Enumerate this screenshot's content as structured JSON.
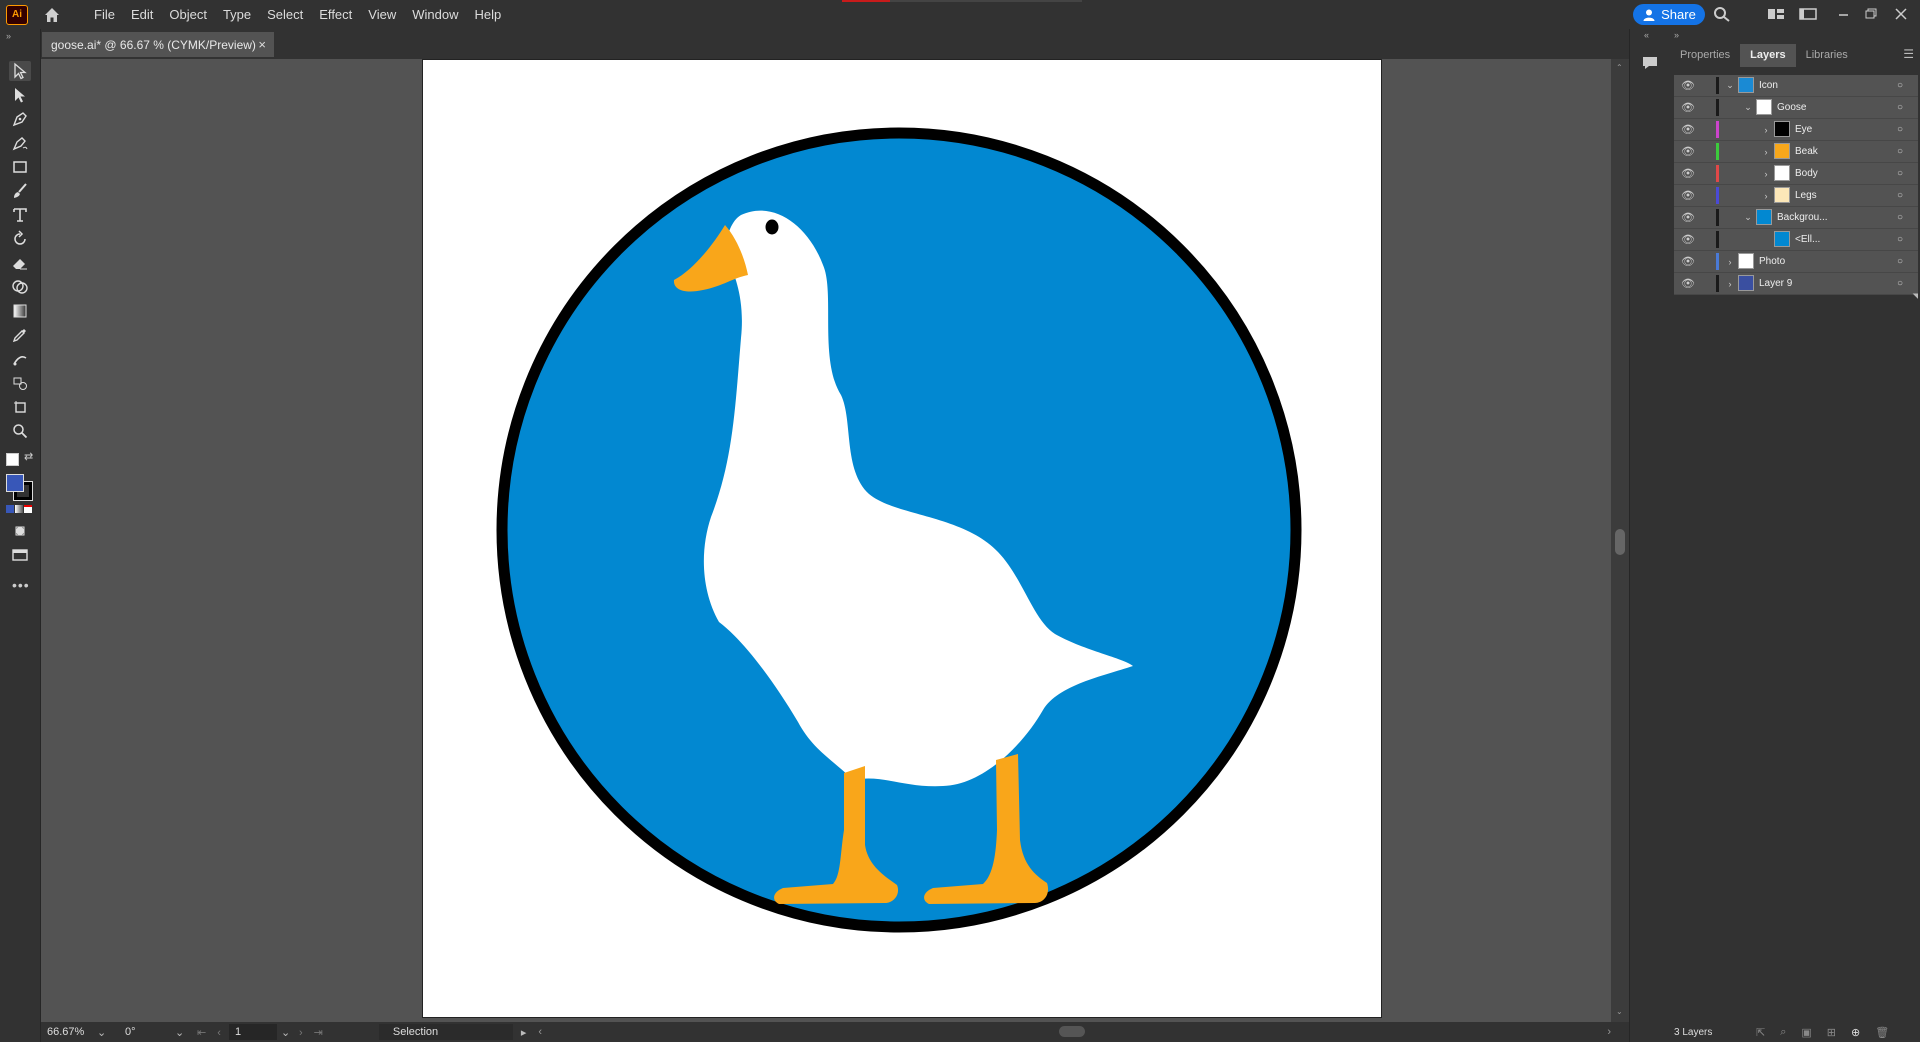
{
  "app": {
    "logo_text": "Ai"
  },
  "menu": {
    "items": [
      "File",
      "Edit",
      "Object",
      "Type",
      "Select",
      "Effect",
      "View",
      "Window",
      "Help"
    ]
  },
  "share": {
    "label": "Share"
  },
  "document": {
    "tab_title": "goose.ai* @ 66.67 % (CYMK/Preview)",
    "close_glyph": "×"
  },
  "status": {
    "zoom": "66.67%",
    "rotation": "0°",
    "artboard": "1",
    "tool": "Selection"
  },
  "panels": {
    "tabs": [
      "Properties",
      "Layers",
      "Libraries"
    ],
    "active_tab": "Layers",
    "layer_count": "3 Layers"
  },
  "layers": [
    {
      "name": "Icon",
      "indent": 0,
      "chevron": "⌄",
      "bar": "#1a1a1a",
      "thumb": "#1a8ad4"
    },
    {
      "name": "Goose",
      "indent": 1,
      "chevron": "⌄",
      "bar": "#1a1a1a",
      "thumb": "#ffffff"
    },
    {
      "name": "Eye",
      "indent": 2,
      "chevron": "›",
      "bar": "#cc44cc",
      "thumb": "#000000"
    },
    {
      "name": "Beak",
      "indent": 2,
      "chevron": "›",
      "bar": "#3ccb3c",
      "thumb": "#f7a71b"
    },
    {
      "name": "Body",
      "indent": 2,
      "chevron": "›",
      "bar": "#e04848",
      "thumb": "#ffffff"
    },
    {
      "name": "Legs",
      "indent": 2,
      "chevron": "›",
      "bar": "#4a4ad6",
      "thumb": "#fce7b8"
    },
    {
      "name": "Backgrou...",
      "indent": 1,
      "chevron": "⌄",
      "bar": "#1a1a1a",
      "thumb": "#0288d1"
    },
    {
      "name": "<Ell...",
      "indent": 2,
      "chevron": "",
      "bar": "#1a1a1a",
      "thumb": "#0288d1"
    },
    {
      "name": "Photo",
      "indent": 0,
      "chevron": "›",
      "bar": "#4a7ad6",
      "thumb": "#ffffff"
    },
    {
      "name": "Layer 9",
      "indent": 0,
      "chevron": "›",
      "bar": "#1a1a1a",
      "thumb": "#3a4fa0"
    }
  ],
  "artwork": {
    "circle_fill": "#0288d1",
    "circle_stroke": "#000000",
    "goose_fill": "#ffffff",
    "beak_legs_fill": "#f9a61a"
  },
  "colors": {
    "fill_swatch": "#3857b8",
    "stroke_swatch": "#000000"
  }
}
